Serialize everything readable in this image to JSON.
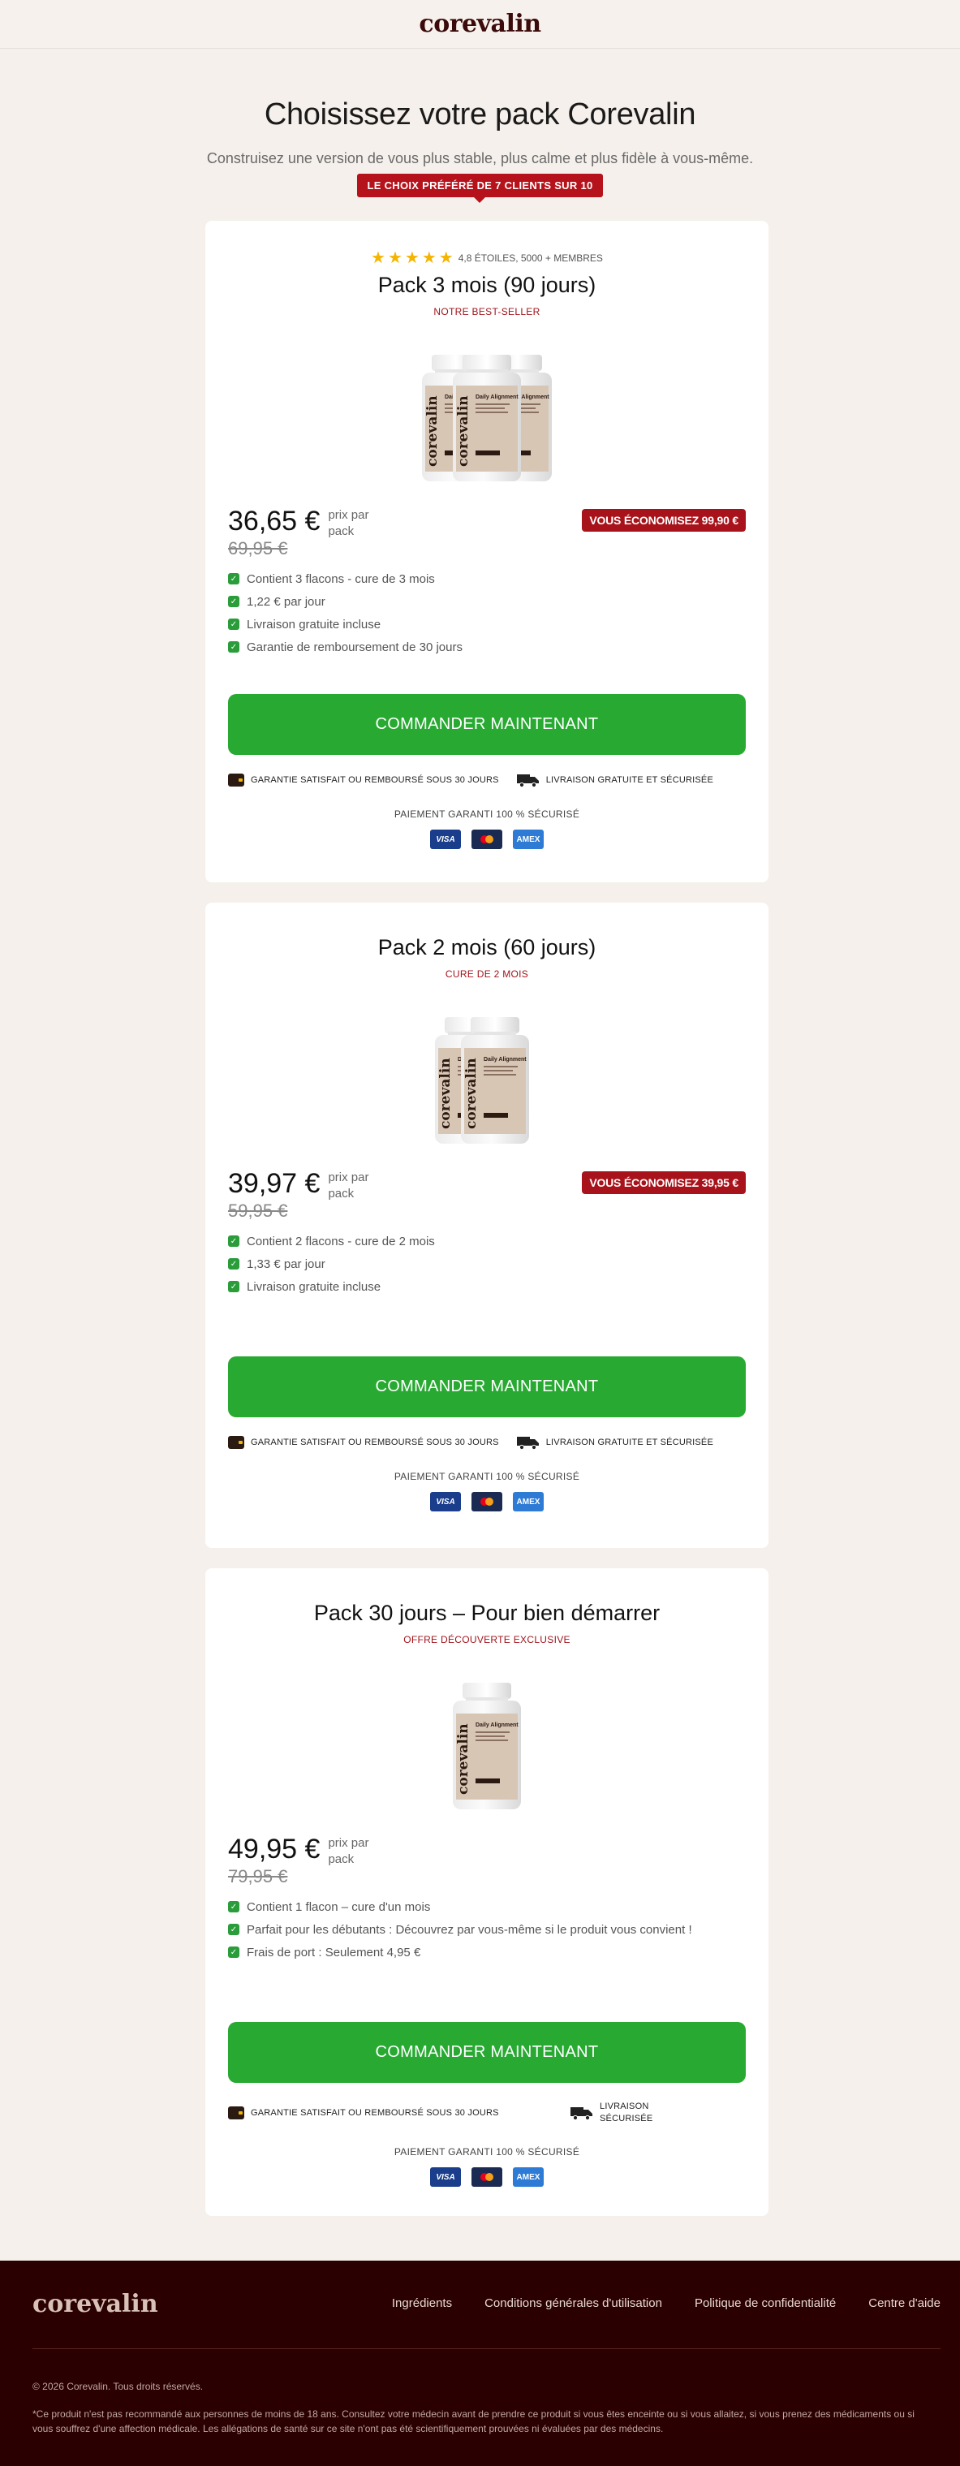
{
  "header": {
    "logo": "corevalin"
  },
  "hero": {
    "title": "Choisissez votre pack Corevalin",
    "subtitle": "Construisez une version de vous plus stable, plus calme et plus fidèle à vous-même.",
    "ribbon": "LE CHOIX PRÉFÉRÉ DE 7 CLIENTS SUR 10"
  },
  "cards": [
    {
      "rating": "4,8 ÉTOILES, 5000 + MEMBRES",
      "stars": 5,
      "title": "Pack 3 mois (90 jours)",
      "subtitle": "NOTRE BEST-SELLER",
      "price": "36,65 €",
      "price_unit": "prix par pack",
      "old_price": "69,95 €",
      "savings": "VOUS ÉCONOMISEZ 99,90 €",
      "features": [
        "Contient 3 flacons - cure de 3 mois",
        "1,22 € par jour",
        "Livraison gratuite incluse",
        "Garantie de remboursement de 30 jours"
      ],
      "cta": "COMMANDER MAINTENANT",
      "guarantee": "GARANTIE SATISFAIT OU REMBOURSÉ SOUS 30 JOURS",
      "shipping": "LIVRAISON GRATUITE ET SÉCURISÉE",
      "payment_title": "PAIEMENT GARANTI 100 % SÉCURISÉ"
    },
    {
      "title": "Pack 2 mois (60 jours)",
      "subtitle": "CURE DE 2 MOIS",
      "price": "39,97 €",
      "price_unit": "prix par pack",
      "old_price": "59,95 €",
      "savings": "VOUS ÉCONOMISEZ 39,95 €",
      "features": [
        "Contient 2 flacons - cure de 2 mois",
        "1,33 € par jour",
        "Livraison gratuite incluse"
      ],
      "cta": "COMMANDER MAINTENANT",
      "guarantee": "GARANTIE SATISFAIT OU REMBOURSÉ SOUS 30 JOURS",
      "shipping": "LIVRAISON GRATUITE ET SÉCURISÉE",
      "payment_title": "PAIEMENT GARANTI 100 % SÉCURISÉ"
    },
    {
      "title": "Pack 30 jours – Pour bien démarrer",
      "subtitle": "OFFRE DÉCOUVERTE EXCLUSIVE",
      "price": "49,95 €",
      "price_unit": "prix par pack",
      "old_price": "79,95 €",
      "features": [
        "Contient 1 flacon – cure d'un mois",
        "Parfait pour les débutants : Découvrez par vous-même si le produit vous convient !",
        "Frais de port : Seulement 4,95 €"
      ],
      "cta": "COMMANDER MAINTENANT",
      "guarantee": "GARANTIE SATISFAIT OU REMBOURSÉ SOUS 30 JOURS",
      "shipping": "LIVRAISON SÉCURISÉE",
      "payment_title": "PAIEMENT GARANTI 100 % SÉCURISÉ"
    }
  ],
  "payment_methods": [
    "VISA",
    "MasterCard",
    "AMEX"
  ],
  "bottle": {
    "brand": "corevalin",
    "label": "Daily Alignment"
  },
  "footer": {
    "logo": "corevalin",
    "nav": [
      "Ingrédients",
      "Conditions générales d'utilisation",
      "Politique de confidentialité",
      "Centre d'aide"
    ],
    "copyright": "© 2026 Corevalin. Tous droits réservés.",
    "disclaimer": "*Ce produit n'est pas recommandé aux personnes de moins de 18 ans. Consultez votre médecin avant de prendre ce produit si vous êtes enceinte ou si vous allaitez, si vous prenez des médicaments ou si vous souffrez d'une affection médicale. Les allégations de santé sur ce site n'ont pas été scientifiquement prouvées ni évaluées par des médecins."
  },
  "colors": {
    "brand": "#3b0a0a",
    "accent_red": "#a8131b",
    "cta_green": "#28a932",
    "star": "#f4b400",
    "footer_bg": "#2b0000",
    "page_bg": "#f5f0eb"
  }
}
